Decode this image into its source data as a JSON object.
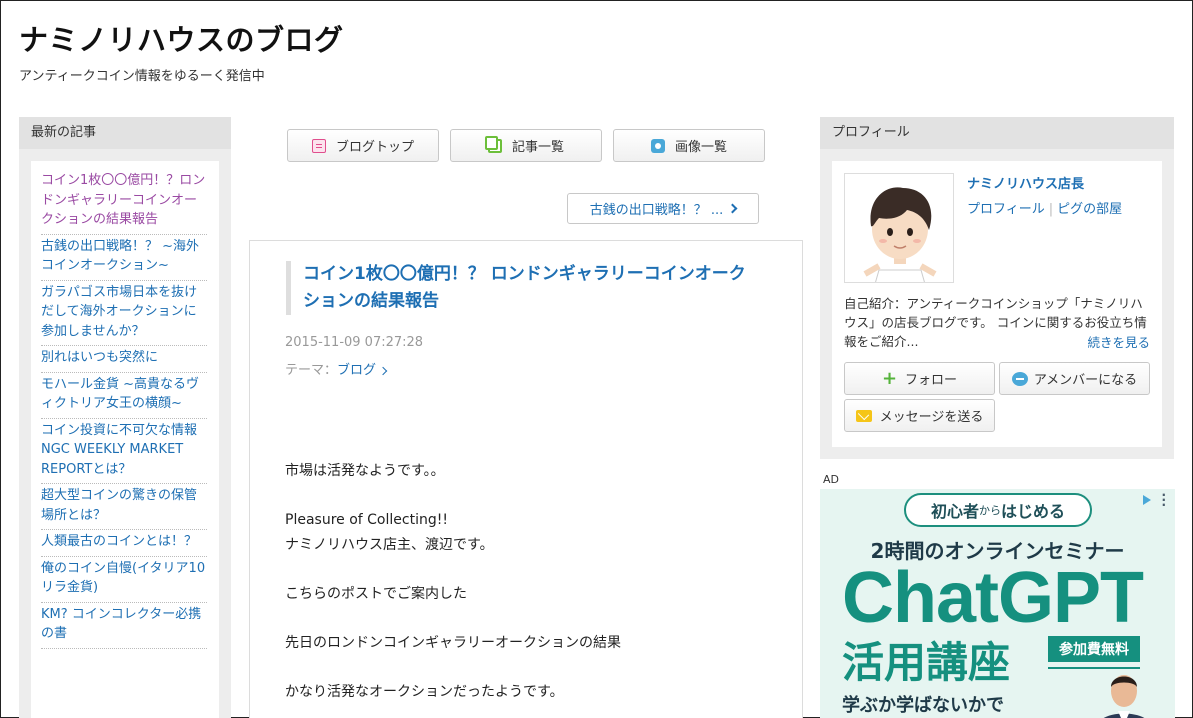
{
  "header": {
    "title": "ナミノリハウスのブログ",
    "description": "アンティークコイン情報をゆるーく発信中"
  },
  "left_sidebar": {
    "heading": "最新の記事",
    "items": [
      {
        "label": "コイン1枚〇〇億円！？ロンドンギャラリーコインオークションの結果報告",
        "visited": true
      },
      {
        "label": "古銭の出口戦略！？ ~海外コインオークション~",
        "visited": false
      },
      {
        "label": "ガラパゴス市場日本を抜けだして海外オークションに参加しませんか？",
        "visited": false
      },
      {
        "label": "別れはいつも突然に",
        "visited": false
      },
      {
        "label": "モハール金貨 ~高貴なるヴィクトリア女王の横顔~",
        "visited": false
      },
      {
        "label": "コイン投資に不可欠な情報 NGC WEEKLY MARKET REPORTとは？",
        "visited": false
      },
      {
        "label": "超大型コインの驚きの保管場所とは？",
        "visited": false
      },
      {
        "label": "人類最古のコインとは！？",
        "visited": false
      },
      {
        "label": "俺のコイン自慢(イタリア10リラ金貨)",
        "visited": false
      },
      {
        "label": "KM? コインコレクター必携の書",
        "visited": false
      }
    ]
  },
  "nav": {
    "blog_top": "ブログトップ",
    "article_list": "記事一覧",
    "image_list": "画像一覧",
    "prev_article": "古銭の出口戦略！？ ..."
  },
  "article": {
    "title": "コイン1枚〇〇億円！？ ロンドンギャラリーコインオークションの結果報告",
    "date": "2015-11-09 07:27:28",
    "theme_label": "テーマ：",
    "theme_value": "ブログ",
    "paragraphs": [
      [
        "市場は活発なようです。。"
      ],
      [
        "Pleasure of Collecting!!",
        "ナミノリハウス店主、渡辺です。"
      ],
      [
        "こちらのポストでご案内した"
      ],
      [
        "先日のロンドンコインギャラリーオークションの結果"
      ],
      [
        "かなり活発なオークションだったようです。"
      ]
    ]
  },
  "profile": {
    "heading": "プロフィール",
    "name": "ナミノリハウス店長",
    "link_profile": "プロフィール",
    "link_pig": "ピグの部屋",
    "intro": "自己紹介：アンティークコインショップ「ナミノリハウス」の店長ブログです。 コインに関するお役立ち情報をご紹介...",
    "more": "続きを見る",
    "follow": "フォロー",
    "amember": "アメンバーになる",
    "message": "メッセージを送る"
  },
  "ad": {
    "label": "AD",
    "pill_a": "初心者",
    "pill_b": "から",
    "pill_c": "はじめる",
    "subtitle": "2時間のオンラインセミナー",
    "main": "ChatGPT",
    "course": "活用講座",
    "badge": "参加費無料",
    "bottom": "学ぶか学ばないかで"
  },
  "colors": {
    "link": "#1e6fb3",
    "visited": "#9a4aa3",
    "ad_green": "#15907f"
  }
}
